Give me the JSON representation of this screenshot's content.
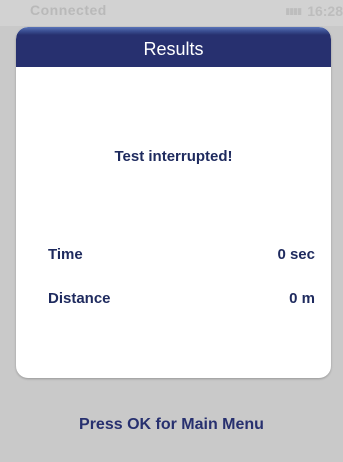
{
  "status_bar": {
    "connection_text": "Connected",
    "signal_icon": "signal-icon",
    "time_text": "16:28"
  },
  "dialog": {
    "title": "Results",
    "message": "Test interrupted!",
    "rows": [
      {
        "label": "Time",
        "value": "0 sec"
      },
      {
        "label": "Distance",
        "value": "0 m"
      }
    ]
  },
  "footer": {
    "prompt": "Press OK for Main Menu"
  },
  "colors": {
    "header_bg": "#27306f",
    "text_primary": "#1e2a5e",
    "background": "#c9c9c9",
    "card": "#ffffff"
  }
}
